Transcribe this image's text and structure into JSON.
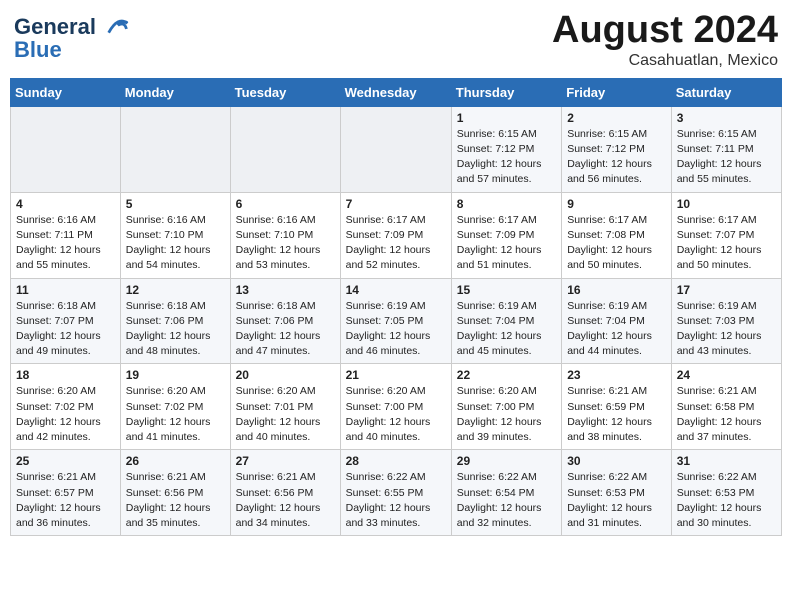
{
  "header": {
    "logo_line1": "General",
    "logo_line2": "Blue",
    "month_year": "August 2024",
    "location": "Casahuatlan, Mexico"
  },
  "days_of_week": [
    "Sunday",
    "Monday",
    "Tuesday",
    "Wednesday",
    "Thursday",
    "Friday",
    "Saturday"
  ],
  "weeks": [
    [
      {
        "day": "",
        "info": ""
      },
      {
        "day": "",
        "info": ""
      },
      {
        "day": "",
        "info": ""
      },
      {
        "day": "",
        "info": ""
      },
      {
        "day": "1",
        "info": "Sunrise: 6:15 AM\nSunset: 7:12 PM\nDaylight: 12 hours\nand 57 minutes."
      },
      {
        "day": "2",
        "info": "Sunrise: 6:15 AM\nSunset: 7:12 PM\nDaylight: 12 hours\nand 56 minutes."
      },
      {
        "day": "3",
        "info": "Sunrise: 6:15 AM\nSunset: 7:11 PM\nDaylight: 12 hours\nand 55 minutes."
      }
    ],
    [
      {
        "day": "4",
        "info": "Sunrise: 6:16 AM\nSunset: 7:11 PM\nDaylight: 12 hours\nand 55 minutes."
      },
      {
        "day": "5",
        "info": "Sunrise: 6:16 AM\nSunset: 7:10 PM\nDaylight: 12 hours\nand 54 minutes."
      },
      {
        "day": "6",
        "info": "Sunrise: 6:16 AM\nSunset: 7:10 PM\nDaylight: 12 hours\nand 53 minutes."
      },
      {
        "day": "7",
        "info": "Sunrise: 6:17 AM\nSunset: 7:09 PM\nDaylight: 12 hours\nand 52 minutes."
      },
      {
        "day": "8",
        "info": "Sunrise: 6:17 AM\nSunset: 7:09 PM\nDaylight: 12 hours\nand 51 minutes."
      },
      {
        "day": "9",
        "info": "Sunrise: 6:17 AM\nSunset: 7:08 PM\nDaylight: 12 hours\nand 50 minutes."
      },
      {
        "day": "10",
        "info": "Sunrise: 6:17 AM\nSunset: 7:07 PM\nDaylight: 12 hours\nand 50 minutes."
      }
    ],
    [
      {
        "day": "11",
        "info": "Sunrise: 6:18 AM\nSunset: 7:07 PM\nDaylight: 12 hours\nand 49 minutes."
      },
      {
        "day": "12",
        "info": "Sunrise: 6:18 AM\nSunset: 7:06 PM\nDaylight: 12 hours\nand 48 minutes."
      },
      {
        "day": "13",
        "info": "Sunrise: 6:18 AM\nSunset: 7:06 PM\nDaylight: 12 hours\nand 47 minutes."
      },
      {
        "day": "14",
        "info": "Sunrise: 6:19 AM\nSunset: 7:05 PM\nDaylight: 12 hours\nand 46 minutes."
      },
      {
        "day": "15",
        "info": "Sunrise: 6:19 AM\nSunset: 7:04 PM\nDaylight: 12 hours\nand 45 minutes."
      },
      {
        "day": "16",
        "info": "Sunrise: 6:19 AM\nSunset: 7:04 PM\nDaylight: 12 hours\nand 44 minutes."
      },
      {
        "day": "17",
        "info": "Sunrise: 6:19 AM\nSunset: 7:03 PM\nDaylight: 12 hours\nand 43 minutes."
      }
    ],
    [
      {
        "day": "18",
        "info": "Sunrise: 6:20 AM\nSunset: 7:02 PM\nDaylight: 12 hours\nand 42 minutes."
      },
      {
        "day": "19",
        "info": "Sunrise: 6:20 AM\nSunset: 7:02 PM\nDaylight: 12 hours\nand 41 minutes."
      },
      {
        "day": "20",
        "info": "Sunrise: 6:20 AM\nSunset: 7:01 PM\nDaylight: 12 hours\nand 40 minutes."
      },
      {
        "day": "21",
        "info": "Sunrise: 6:20 AM\nSunset: 7:00 PM\nDaylight: 12 hours\nand 40 minutes."
      },
      {
        "day": "22",
        "info": "Sunrise: 6:20 AM\nSunset: 7:00 PM\nDaylight: 12 hours\nand 39 minutes."
      },
      {
        "day": "23",
        "info": "Sunrise: 6:21 AM\nSunset: 6:59 PM\nDaylight: 12 hours\nand 38 minutes."
      },
      {
        "day": "24",
        "info": "Sunrise: 6:21 AM\nSunset: 6:58 PM\nDaylight: 12 hours\nand 37 minutes."
      }
    ],
    [
      {
        "day": "25",
        "info": "Sunrise: 6:21 AM\nSunset: 6:57 PM\nDaylight: 12 hours\nand 36 minutes."
      },
      {
        "day": "26",
        "info": "Sunrise: 6:21 AM\nSunset: 6:56 PM\nDaylight: 12 hours\nand 35 minutes."
      },
      {
        "day": "27",
        "info": "Sunrise: 6:21 AM\nSunset: 6:56 PM\nDaylight: 12 hours\nand 34 minutes."
      },
      {
        "day": "28",
        "info": "Sunrise: 6:22 AM\nSunset: 6:55 PM\nDaylight: 12 hours\nand 33 minutes."
      },
      {
        "day": "29",
        "info": "Sunrise: 6:22 AM\nSunset: 6:54 PM\nDaylight: 12 hours\nand 32 minutes."
      },
      {
        "day": "30",
        "info": "Sunrise: 6:22 AM\nSunset: 6:53 PM\nDaylight: 12 hours\nand 31 minutes."
      },
      {
        "day": "31",
        "info": "Sunrise: 6:22 AM\nSunset: 6:53 PM\nDaylight: 12 hours\nand 30 minutes."
      }
    ]
  ]
}
